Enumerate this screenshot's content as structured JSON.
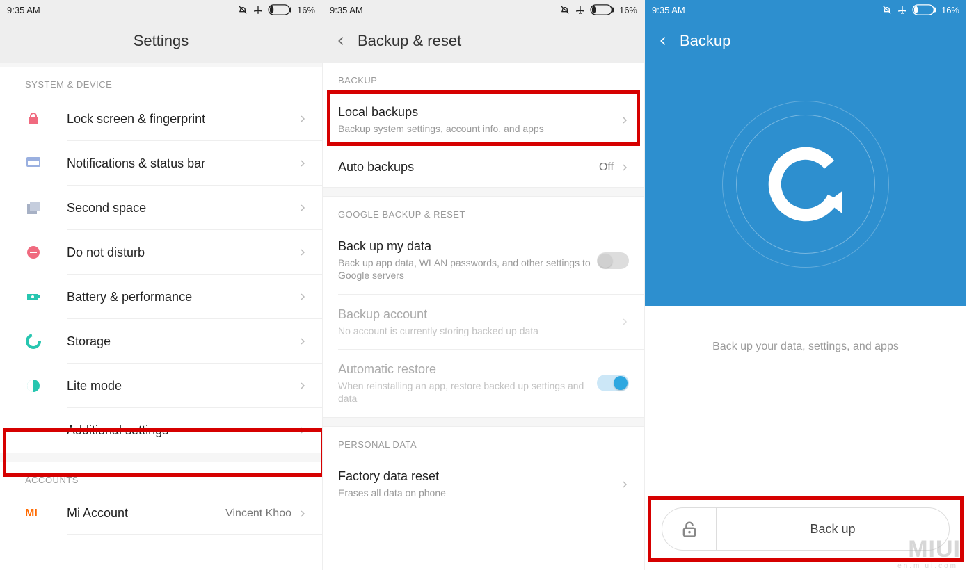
{
  "status": {
    "time": "9:35 AM",
    "battery": "16%"
  },
  "screen1": {
    "title": "Settings",
    "section_system": "SYSTEM & DEVICE",
    "rows": {
      "lock": "Lock screen & fingerprint",
      "notif": "Notifications & status bar",
      "second_space": "Second space",
      "dnd": "Do not disturb",
      "battery": "Battery & performance",
      "storage": "Storage",
      "lite": "Lite mode",
      "additional": "Additional settings"
    },
    "section_accounts": "ACCOUNTS",
    "mi_account": {
      "label": "Mi Account",
      "value": "Vincent Khoo"
    }
  },
  "screen2": {
    "title": "Backup & reset",
    "section_backup": "BACKUP",
    "local": {
      "title": "Local backups",
      "sub": "Backup system settings, account info, and apps"
    },
    "auto": {
      "title": "Auto backups",
      "value": "Off"
    },
    "section_google": "GOOGLE BACKUP & RESET",
    "backup_my_data": {
      "title": "Back up my data",
      "sub": "Back up app data, WLAN passwords, and other settings to Google servers"
    },
    "backup_account": {
      "title": "Backup account",
      "sub": "No account is currently storing backed up data"
    },
    "auto_restore": {
      "title": "Automatic restore",
      "sub": "When reinstalling an app, restore backed up settings and data"
    },
    "section_personal": "PERSONAL DATA",
    "factory": {
      "title": "Factory data reset",
      "sub": "Erases all data on phone"
    }
  },
  "screen3": {
    "title": "Backup",
    "hint": "Back up your data, settings, and apps",
    "button": "Back up"
  },
  "watermark": "MIUI",
  "watermark_sub": "en.miui.com"
}
